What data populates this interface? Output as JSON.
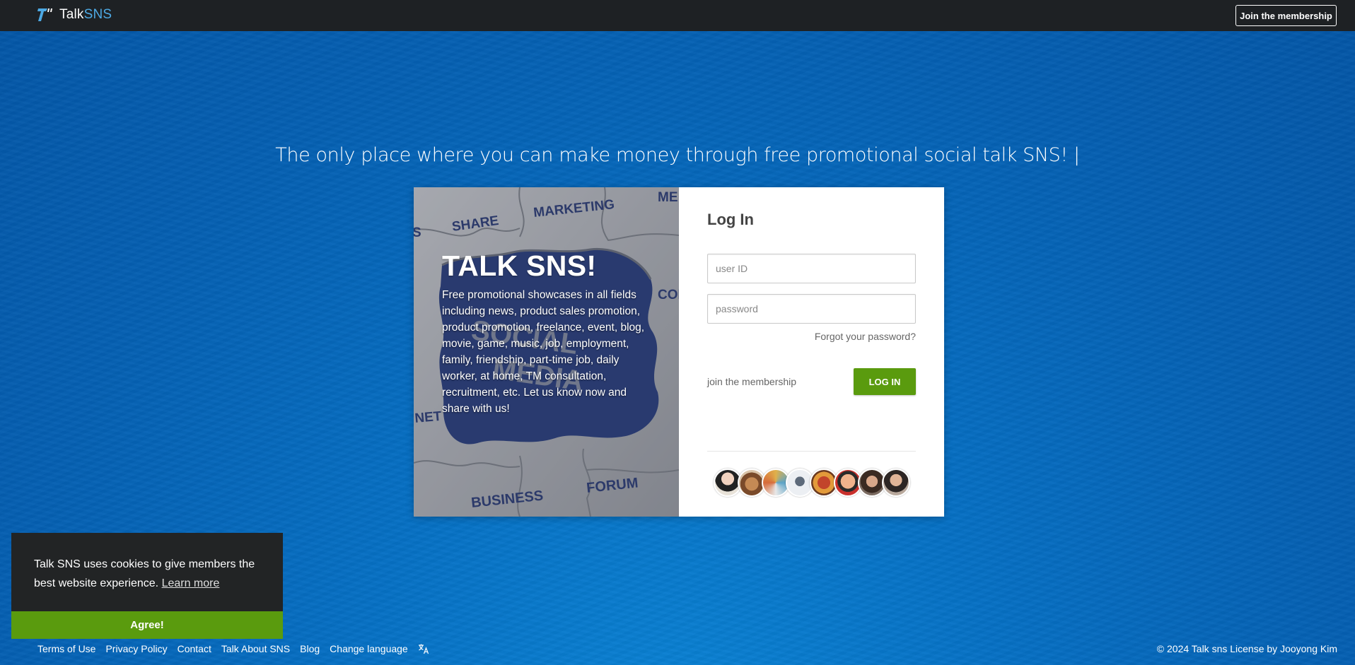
{
  "header": {
    "brand_prefix": "Talk",
    "brand_accent": "SNS",
    "join_button": "Join the membership"
  },
  "headline": "The only place where you can make money through free promotional social talk SNS! |",
  "promo": {
    "title": "TALK SNS!",
    "description": "Free promotional showcases in all fields including news, product sales promotion, product promotion, freelance, event, blog, movie, game, music, job, employment, family, friendship, part-time job, daily worker, at home, TM consultation, recruitment, etc. Let us know now and share with us!",
    "puzzle_words": [
      "SHARE",
      "MARKETING",
      "ME",
      "COM",
      "SOCIAL",
      "MEDIA",
      "NET",
      "BUSINESS",
      "FORUM",
      "S"
    ]
  },
  "login": {
    "title": "Log In",
    "user_placeholder": "user ID",
    "password_placeholder": "password",
    "forgot": "Forgot your password?",
    "join": "join the membership",
    "button": "LOG IN"
  },
  "cookie": {
    "text": "Talk SNS uses cookies to give members the best website experience.",
    "learn_more": "Learn more",
    "agree": "Agree!"
  },
  "footer": {
    "links": [
      "Terms of Use",
      "Privacy Policy",
      "Contact",
      "Talk About SNS",
      "Blog",
      "Change language"
    ],
    "copyright": "© 2024 Talk sns License by Jooyong Kim"
  },
  "colors": {
    "topbar": "#1e2124",
    "brand_accent": "#4da9e4",
    "green_button": "#5a9b0e",
    "background_blue": "#0670c4"
  }
}
